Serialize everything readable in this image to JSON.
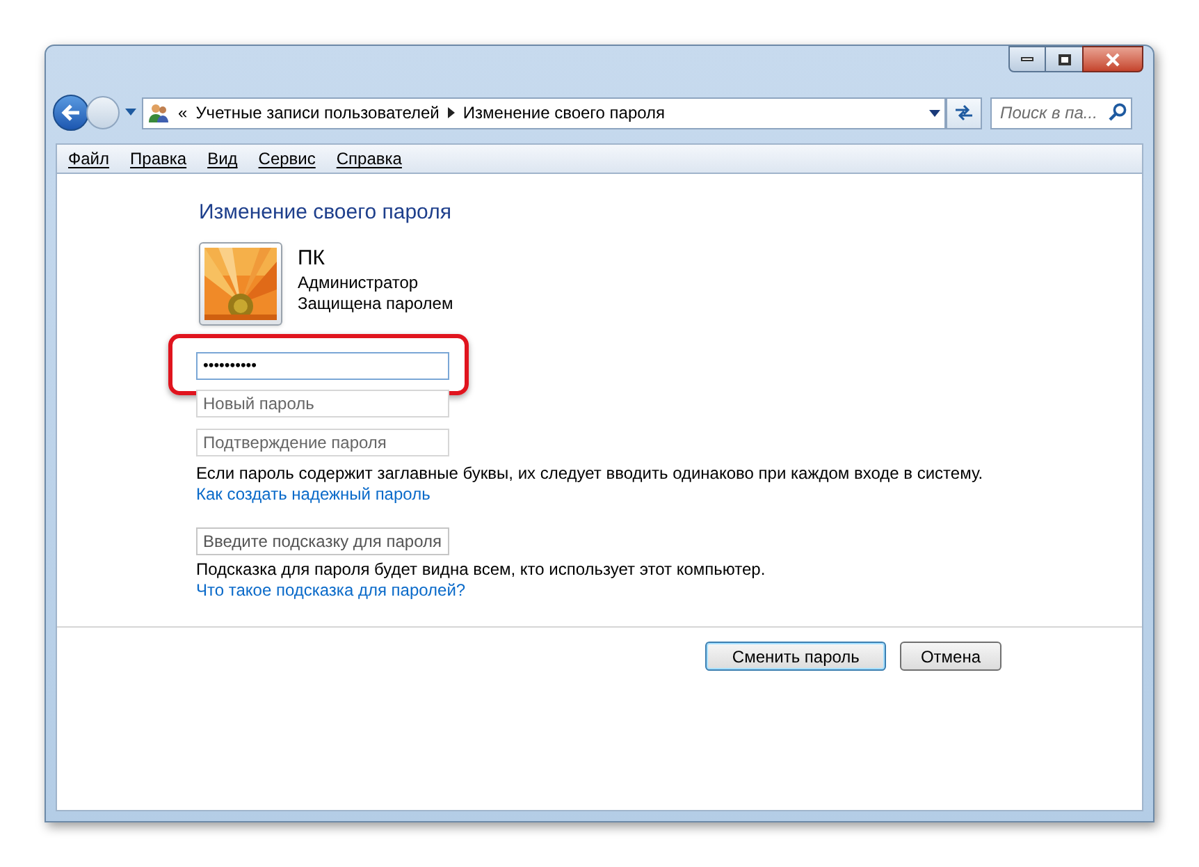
{
  "address_bar": {
    "overflow": "«",
    "crumbs": [
      "Учетные записи пользователей",
      "Изменение своего пароля"
    ],
    "search_placeholder": "Поиск в па..."
  },
  "menu": [
    "Файл",
    "Правка",
    "Вид",
    "Сервис",
    "Справка"
  ],
  "title": "Изменение своего пароля",
  "user": {
    "name": "ПК",
    "role": "Администратор",
    "status": "Защищена паролем"
  },
  "fields": [
    {
      "value": "••••••••••",
      "highlighted": true
    },
    {
      "placeholder": "Новый пароль",
      "highlighted": false
    },
    {
      "placeholder": "Подтверждение пароля",
      "highlighted": false
    }
  ],
  "note": "Если пароль содержит заглавные буквы, их следует вводить одинаково при каждом входе в систему.",
  "link_strong": "Как создать надежный пароль",
  "hint_field": {
    "placeholder": "Введите подсказку для пароля"
  },
  "hint_note": "Подсказка для пароля будет видна всем, кто использует этот компьютер.",
  "link_hint": "Что такое подсказка для паролей?",
  "buttons": [
    {
      "label": "Сменить пароль",
      "default": true
    },
    {
      "label": "Отмена",
      "default": false
    }
  ]
}
